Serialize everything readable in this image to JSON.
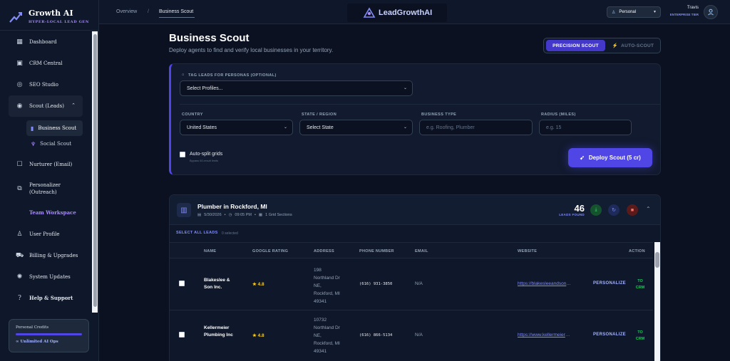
{
  "brand": {
    "title": "Growth AI",
    "subtitle": "HYPER-LOCAL LEAD GEN"
  },
  "sidebar": {
    "items": [
      {
        "label": "Dashboard",
        "icon": "grid-icon"
      },
      {
        "label": "CRM Central",
        "icon": "contacts-icon"
      },
      {
        "label": "SEO Studio",
        "icon": "target-icon"
      },
      {
        "label": "Scout (Leads)",
        "icon": "radar-icon"
      },
      {
        "label": "Nurturer (Email)",
        "icon": "inbox-icon"
      },
      {
        "label": "Personalizer (Outreach)",
        "icon": "copy-icon"
      },
      {
        "label": "Team Workspace",
        "icon": ""
      },
      {
        "label": "User Profile",
        "icon": "user-icon"
      },
      {
        "label": "Billing & Upgrades",
        "icon": "cart-icon"
      },
      {
        "label": "System Updates",
        "icon": "megaphone-icon"
      },
      {
        "label": "Help & Support",
        "icon": "help-icon"
      }
    ],
    "subitems": [
      {
        "label": "Business Scout",
        "icon": "building-icon"
      },
      {
        "label": "Social Scout",
        "icon": "social-icon"
      }
    ],
    "credits": {
      "label": "Personal Credits",
      "value": "∞ Unlimited AI Ops"
    }
  },
  "topbar": {
    "crumbs": [
      "Overview",
      "/",
      "Business Scout"
    ],
    "logo_text": "LeadGrowthAI",
    "persona": "Personal",
    "user_name": "Travis",
    "user_tier": "ENTERPRISE TIER"
  },
  "header": {
    "title": "Business Scout",
    "subtitle": "Deploy agents to find and verify local businesses in your territory.",
    "mode_a": "PRECISION SCOUT",
    "mode_b": "AUTO-SCOUT"
  },
  "form": {
    "tag_label": "TAG LEADS FOR PERSONAS (OPTIONAL)",
    "tag_value": "Select Profiles...",
    "country_label": "COUNTRY",
    "country_value": "United States",
    "state_label": "STATE / REGION",
    "state_value": "Select State",
    "type_label": "BUSINESS TYPE",
    "type_placeholder": "e.g. Roofing, Plumber",
    "radius_label": "RADIUS (MILES)",
    "radius_placeholder": "e.g. 15",
    "autosplit_label": "Auto-split grids",
    "autosplit_hint": "Bypass 60-result limits",
    "deploy_label": "Deploy Scout (5 cr)"
  },
  "results": {
    "title": "Plumber in Rockford, MI",
    "date": "5/30/2026",
    "time": "09:05 PM",
    "sections": "1 Grid Sections",
    "leads_count": "46",
    "leads_label": "LEADS FOUND",
    "select_all": "SELECT ALL LEADS",
    "selected": "0 selected",
    "columns": [
      "NAME",
      "GOOGLE RATING",
      "ADDRESS",
      "PHONE NUMBER",
      "EMAIL",
      "WEBSITE",
      "ACTION"
    ],
    "rows": [
      {
        "name": "Blakeslee & Son Inc.",
        "rating": "4.8",
        "address": "198 Northland Dr NE, Rockford, MI 49341",
        "phone": "(616) 931-3850",
        "email": "N/A",
        "website": "https://blakesleeandson.com",
        "personalize": "PERSONALIZE",
        "tocrm": "TO CRM"
      },
      {
        "name": "Kellermeier Plumbing Inc",
        "rating": "4.8",
        "address": "10732 Northland Dr NE, Rockford, MI 49341",
        "phone": "(616) 866-5134",
        "email": "N/A",
        "website": "https://www.kellermeierplumbing.com",
        "personalize": "PERSONALIZE",
        "tocrm": "TO CRM"
      }
    ]
  },
  "colors": {
    "accent": "#4f46e5",
    "success": "#22c55e",
    "danger": "#dc2626",
    "star": "#facc15"
  }
}
